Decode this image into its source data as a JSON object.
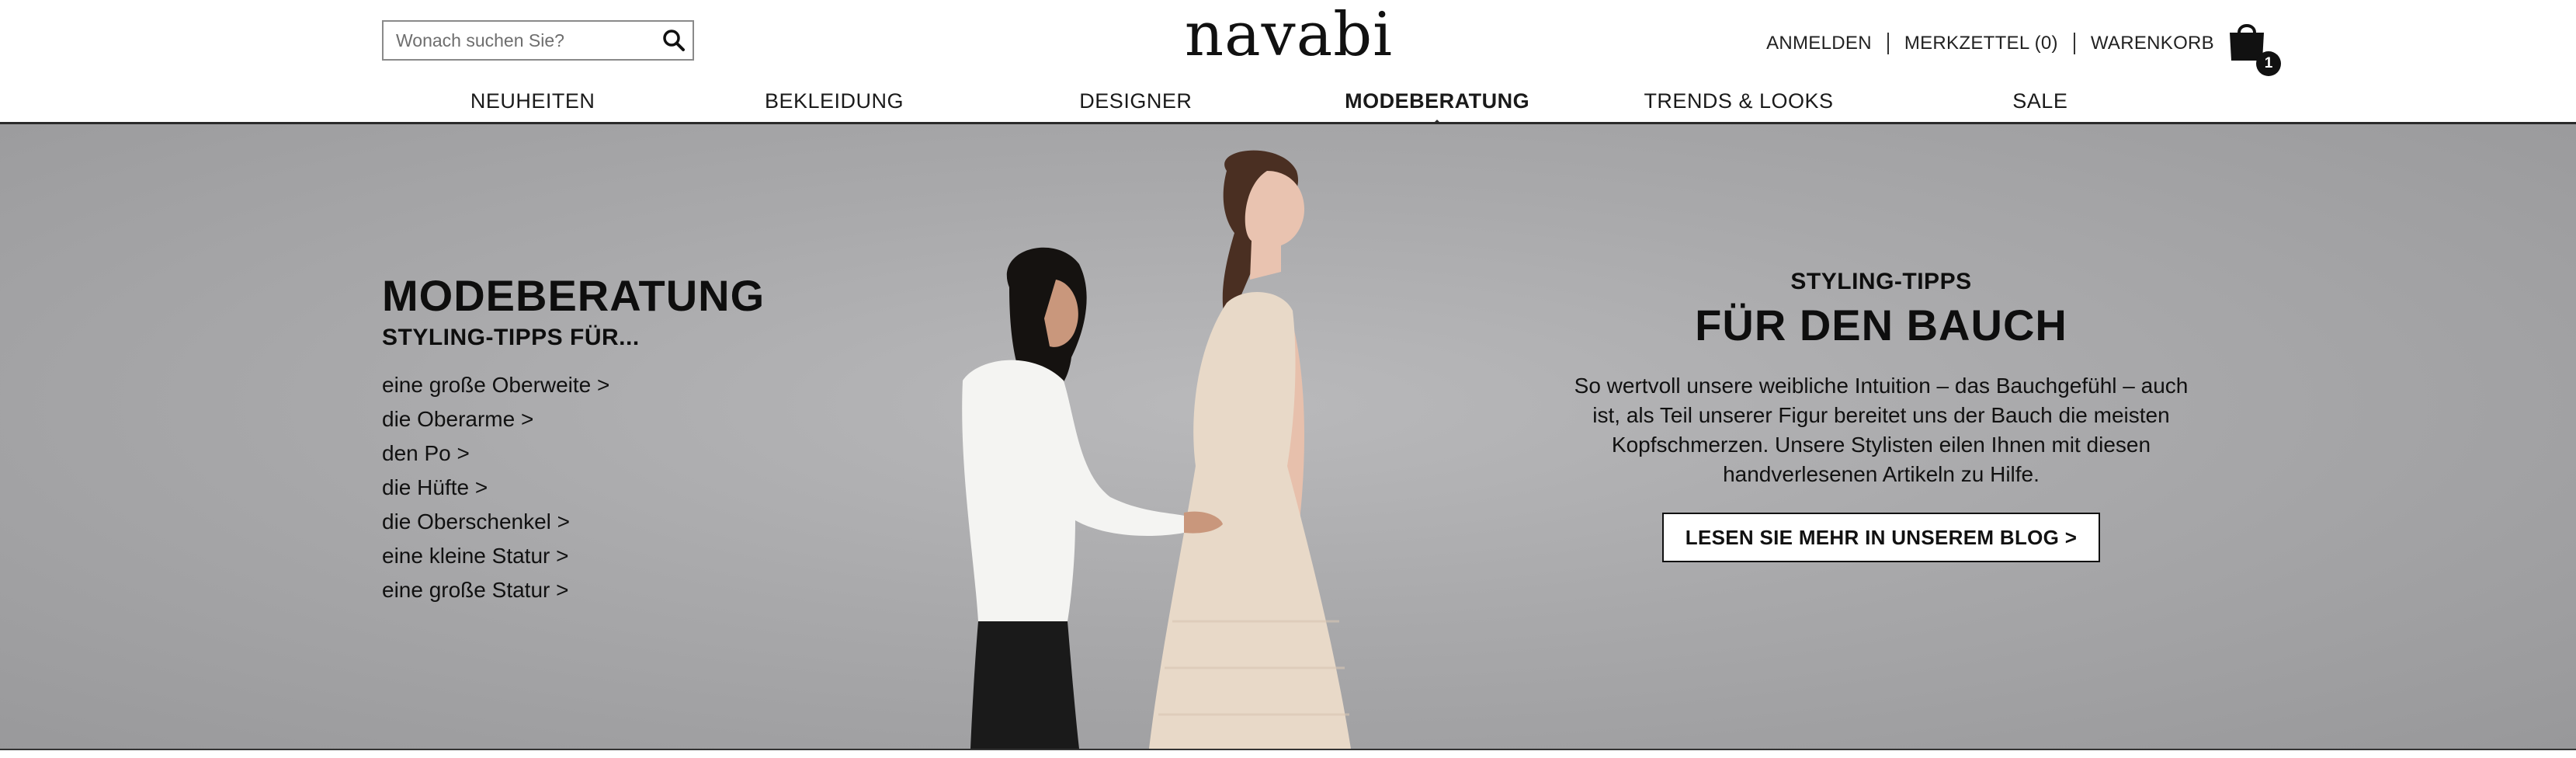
{
  "search": {
    "placeholder": "Wonach suchen Sie?"
  },
  "brand": {
    "logo_text": "navabi"
  },
  "utility_nav": {
    "login": "ANMELDEN",
    "wishlist": "MERKZETTEL (0)",
    "cart": "WARENKORB",
    "cart_count": "1"
  },
  "main_nav": {
    "items": [
      {
        "label": "NEUHEITEN"
      },
      {
        "label": "BEKLEIDUNG"
      },
      {
        "label": "DESIGNER"
      },
      {
        "label": "MODEBERATUNG",
        "active": true
      },
      {
        "label": "TRENDS & LOOKS"
      },
      {
        "label": "SALE"
      }
    ]
  },
  "hero": {
    "left": {
      "title": "MODEBERATUNG",
      "subtitle": "STYLING-TIPPS FÜR...",
      "links": [
        "eine große Oberweite >",
        "die Oberarme >",
        "den Po >",
        "die Hüfte >",
        "die Oberschenkel >",
        "eine kleine Statur >",
        "eine große Statur >"
      ]
    },
    "right": {
      "kicker": "STYLING-TIPPS",
      "title": "FÜR DEN BAUCH",
      "text": "So wertvoll unsere weibliche Intuition – das Bauchgefühl – auch ist, als Teil unserer Figur bereitet uns der Bauch die meisten Kopfschmerzen. Unsere Stylisten eilen Ihnen mit diesen handverlesenen Artikeln zu Hilfe.",
      "button_label": "LESEN SIE MEHR IN UNSEREM BLOG >"
    }
  },
  "icons": {
    "search": "search-icon",
    "cart": "shopping-bag-icon"
  },
  "colors": {
    "text": "#111111",
    "hero_background": "#a9a9ab",
    "dress": "#e8d9c8",
    "shirt": "#f4f4f2"
  }
}
